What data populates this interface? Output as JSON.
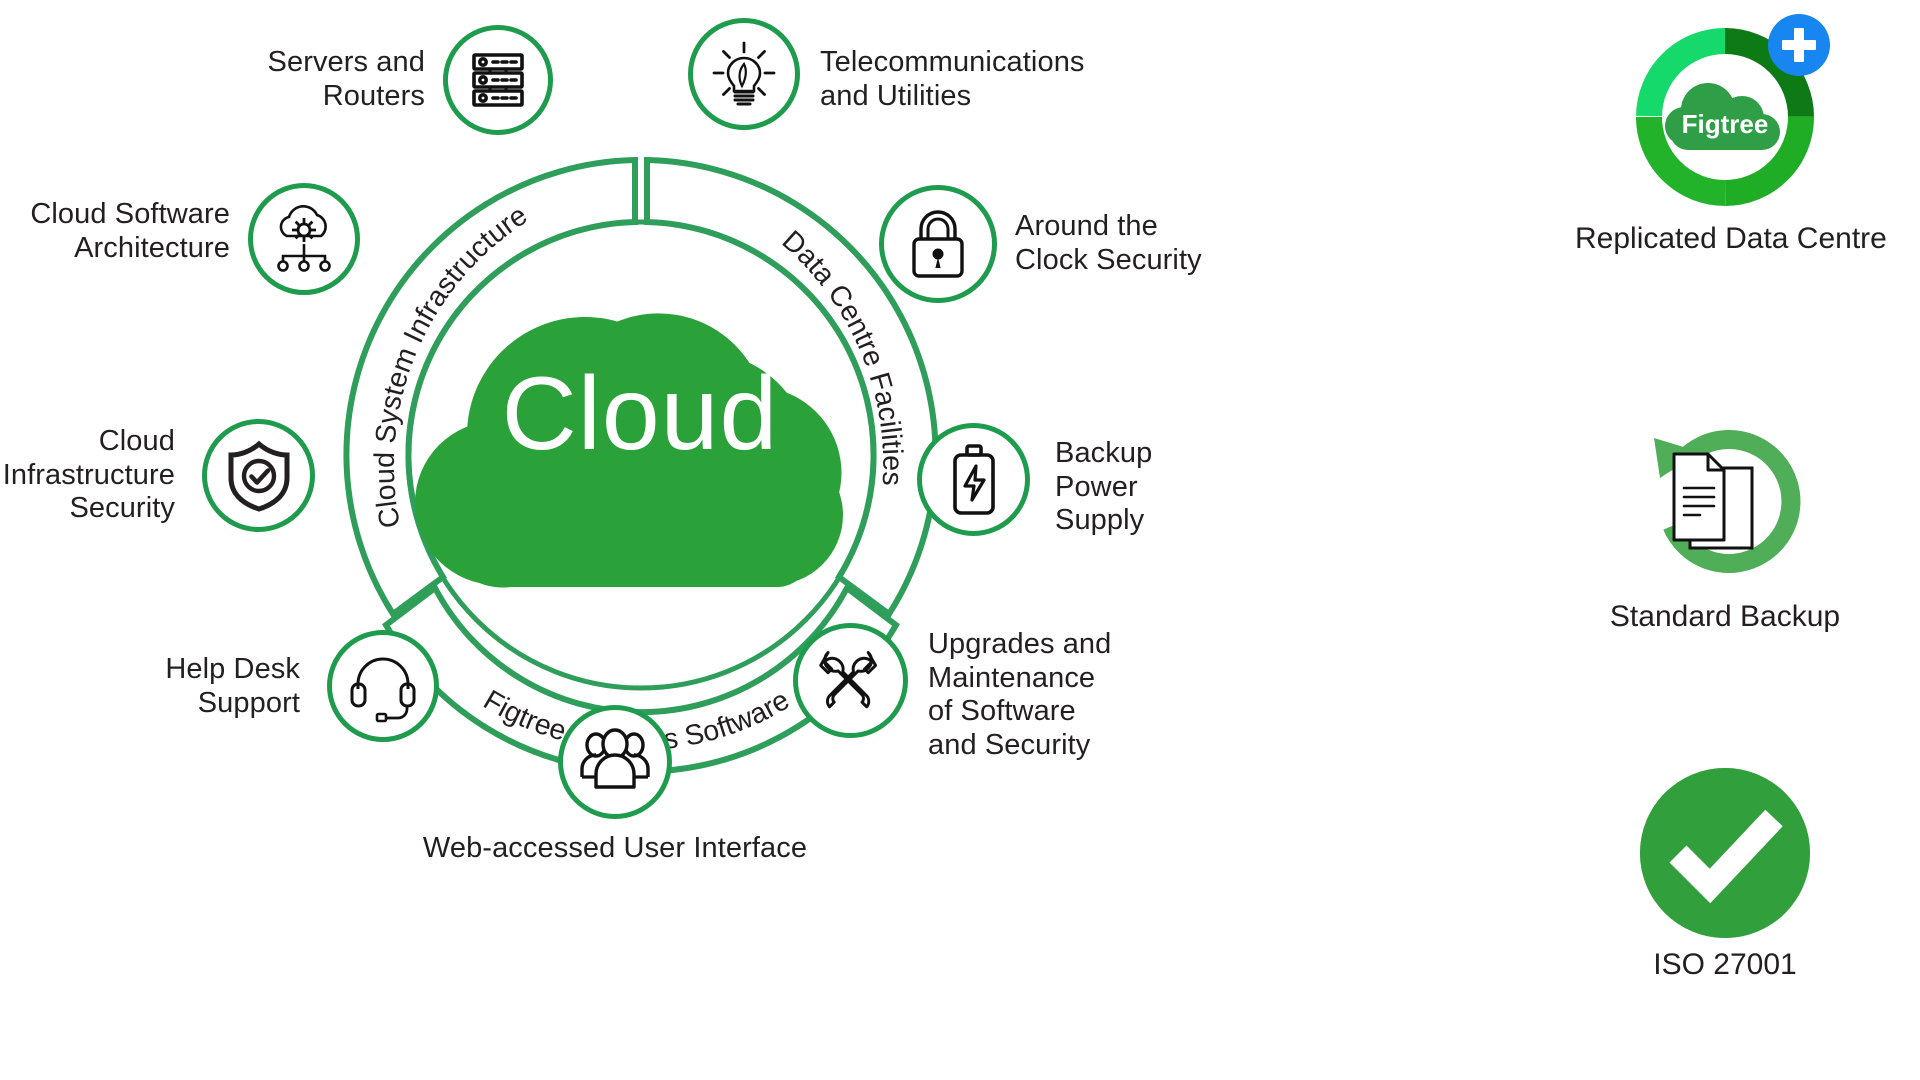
{
  "center": {
    "label": "Cloud",
    "cloud_color": "#2ba13a"
  },
  "arcs": [
    {
      "id": "cloud-system-infrastructure",
      "label": "Cloud System Infrastructure"
    },
    {
      "id": "data-centre-facilities",
      "label": "Data Centre Facilities"
    },
    {
      "id": "figtree-systems-software",
      "label": "Figtree Systems Software"
    }
  ],
  "ring_color": "#2f9e5a",
  "nodes": [
    {
      "id": "servers-and-routers",
      "label": "Servers and\nRouters",
      "icon": "server-rack-icon"
    },
    {
      "id": "telecommunications",
      "label": "Telecommunications\nand Utilities",
      "icon": "lightbulb-leaf-icon"
    },
    {
      "id": "cloud-software-architecture",
      "label": "Cloud Software\nArchitecture",
      "icon": "cloud-gear-network-icon"
    },
    {
      "id": "around-the-clock-security",
      "label": "Around the\nClock Security",
      "icon": "padlock-icon"
    },
    {
      "id": "cloud-infrastructure-security",
      "label": "Cloud\nInfrastructure\nSecurity",
      "icon": "shield-check-icon"
    },
    {
      "id": "backup-power-supply",
      "label": "Backup\nPower\nSupply",
      "icon": "battery-bolt-icon"
    },
    {
      "id": "help-desk-support",
      "label": "Help Desk\nSupport",
      "icon": "headset-icon"
    },
    {
      "id": "upgrades-and-maintenance",
      "label": "Upgrades and\nMaintenance\nof Software\nand Security",
      "icon": "crossed-wrenches-icon"
    },
    {
      "id": "web-accessed-user-interface",
      "label": "Web-accessed User Interface",
      "icon": "users-group-icon"
    }
  ],
  "rail": [
    {
      "id": "replicated-data-centre",
      "label": "Replicated Data Centre",
      "icon": "figtree-cloud-ring-icon",
      "brand": "Figtree",
      "badge": "plus-badge"
    },
    {
      "id": "standard-backup",
      "label": "Standard Backup",
      "icon": "refresh-documents-icon"
    },
    {
      "id": "iso-27001",
      "label": "ISO 27001",
      "icon": "green-check-circle-icon"
    }
  ],
  "colors": {
    "green": "#2f9e5a",
    "cloud_green": "#2ba13a",
    "iso_green": "#31a03c",
    "badge_blue": "#1786f0",
    "ring_light": "#16d96b",
    "ring_dark": "#0e7a16",
    "ring_mid": "#1fad26",
    "ring_bright": "#22b32b",
    "ink": "#231f20"
  }
}
